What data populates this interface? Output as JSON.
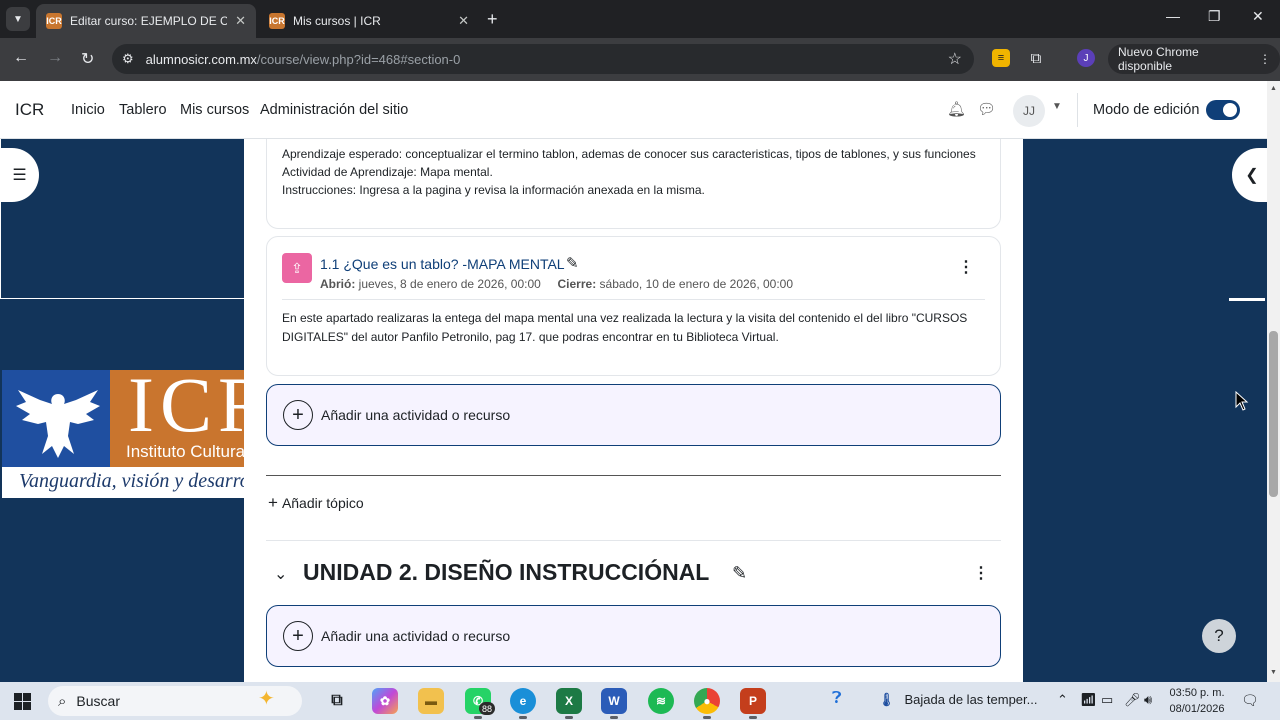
{
  "browser": {
    "tabs": [
      {
        "title": "Editar curso: EJEMPLO DE CURSO",
        "favicon": "ICR",
        "active": true
      },
      {
        "title": "Mis cursos | ICR",
        "favicon": "ICR",
        "active": false
      }
    ],
    "url_host": "alumnosicr.com.mx",
    "url_path": "/course/view.php?id=468#section-0",
    "profile_initial": "J",
    "update_label": "Nuevo Chrome disponible"
  },
  "navbar": {
    "brand": "ICR",
    "links": [
      "Inicio",
      "Tablero",
      "Mis cursos",
      "Administración del sitio"
    ],
    "user_initials": "JJ",
    "edit_mode_label": "Modo de edición",
    "edit_mode_on": true
  },
  "logo": {
    "letters": "ICR",
    "subtitle": "Instituto Cultural",
    "motto": "Vanguardia, visión y desarrollo"
  },
  "content": {
    "intro_lines": [
      "Aprendizaje esperado: conceptualizar el termino tablon, ademas de conocer sus caracteristicas, tipos de tablones, y sus funciones",
      "Actividad de Aprendizaje: Mapa mental.",
      "Instrucciones: Ingresa a la pagina y revisa la información anexada en la misma."
    ],
    "activity": {
      "title": "1.1 ¿Que es un tablo? -MAPA MENTAL",
      "opened_label": "Abrió:",
      "opened_value": "jueves, 8 de enero de 2026, 00:00",
      "closes_label": "Cierre:",
      "closes_value": "sábado, 10 de enero de 2026, 00:00",
      "description": "En este apartado realizaras la entega del mapa mental una vez realizada la lectura y la visita del contenido el del libro \"CURSOS DIGITALES\" del autor Panfilo Petronilo, pag 17. que podras encontrar en tu Biblioteca Virtual."
    },
    "add_activity_label": "Añadir una actividad o recurso",
    "add_topic_label": "Añadir tópico",
    "section_title": "UNIDAD 2. DISEÑO INSTRUCCIÓNAL",
    "help_label": "?"
  },
  "taskbar": {
    "search_placeholder": "Buscar",
    "whatsapp_badge": "88",
    "weather_text": "Bajada de las temper...",
    "time": "03:50 p. m.",
    "date": "08/01/2026"
  },
  "colors": {
    "page_bg": "#12345a",
    "primary": "#0f3f78",
    "assign_icon": "#eb66a2",
    "add_button_bg": "#f6f3ff"
  }
}
